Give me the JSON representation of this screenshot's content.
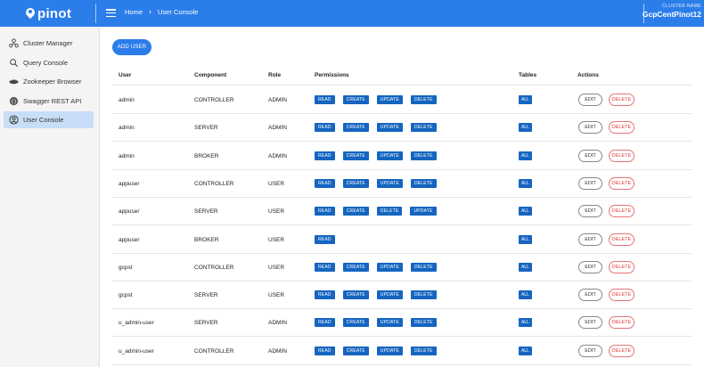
{
  "header": {
    "logo_text": "pinot",
    "breadcrumb": {
      "home": "Home",
      "current": "User Console"
    },
    "cluster_label": "CLUSTER NAME",
    "cluster_name": "GcpCentPinot12"
  },
  "sidebar": {
    "items": [
      {
        "label": "Cluster Manager",
        "icon": "cluster-icon",
        "active": false
      },
      {
        "label": "Query Console",
        "icon": "query-icon",
        "active": false
      },
      {
        "label": "Zookeeper Browser",
        "icon": "zookeeper-icon",
        "active": false
      },
      {
        "label": "Swagger REST API",
        "icon": "swagger-icon",
        "active": false
      },
      {
        "label": "User Console",
        "icon": "user-icon",
        "active": true
      }
    ]
  },
  "main": {
    "add_user_label": "ADD USER",
    "columns": [
      "User",
      "Component",
      "Role",
      "Permissions",
      "Tables",
      "Actions"
    ],
    "edit_label": "EDIT",
    "delete_label": "DELETE",
    "rows": [
      {
        "user": "admin",
        "component": "CONTROLLER",
        "role": "ADMIN",
        "permissions": [
          "READ",
          "CREATE",
          "UPDATE",
          "DELETE"
        ],
        "tables": [
          "ALL"
        ]
      },
      {
        "user": "admin",
        "component": "SERVER",
        "role": "ADMIN",
        "permissions": [
          "READ",
          "CREATE",
          "UPDATE",
          "DELETE"
        ],
        "tables": [
          "ALL"
        ]
      },
      {
        "user": "admin",
        "component": "BROKER",
        "role": "ADMIN",
        "permissions": [
          "READ",
          "CREATE",
          "UPDATE",
          "DELETE"
        ],
        "tables": [
          "ALL"
        ]
      },
      {
        "user": "appuser",
        "component": "CONTROLLER",
        "role": "USER",
        "permissions": [
          "READ",
          "CREATE",
          "UPDATE",
          "DELETE"
        ],
        "tables": [
          "ALL"
        ]
      },
      {
        "user": "appuser",
        "component": "SERVER",
        "role": "USER",
        "permissions": [
          "READ",
          "CREATE",
          "DELETE",
          "UPDATE"
        ],
        "tables": [
          "ALL"
        ]
      },
      {
        "user": "appuser",
        "component": "BROKER",
        "role": "USER",
        "permissions": [
          "READ"
        ],
        "tables": [
          "ALL"
        ]
      },
      {
        "user": "gcpst",
        "component": "CONTROLLER",
        "role": "USER",
        "permissions": [
          "READ",
          "CREATE",
          "UPDATE",
          "DELETE"
        ],
        "tables": [
          "ALL"
        ]
      },
      {
        "user": "gcpst",
        "component": "SERVER",
        "role": "USER",
        "permissions": [
          "READ",
          "CREATE",
          "UPDATE",
          "DELETE"
        ],
        "tables": [
          "ALL"
        ]
      },
      {
        "user": "u_admin-user",
        "component": "SERVER",
        "role": "ADMIN",
        "permissions": [
          "READ",
          "CREATE",
          "UPDATE",
          "DELETE"
        ],
        "tables": [
          "ALL"
        ]
      },
      {
        "user": "u_admin-user",
        "component": "CONTROLLER",
        "role": "ADMIN",
        "permissions": [
          "READ",
          "CREATE",
          "UPDATE",
          "DELETE"
        ],
        "tables": [
          "ALL"
        ]
      }
    ]
  },
  "colors": {
    "header_bg": "#2b7de9",
    "chip_bg": "#1565c0",
    "active_nav": "#c8ddf7",
    "delete_color": "#e53935"
  }
}
